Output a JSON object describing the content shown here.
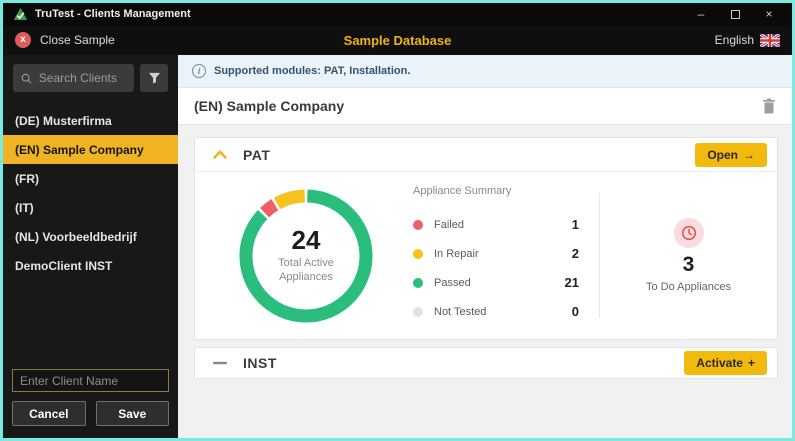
{
  "window": {
    "title": "TruTest - Clients Management",
    "controls": {
      "minimize": "–",
      "close": "×"
    }
  },
  "header": {
    "close_label": "Close Sample",
    "close_glyph": "x",
    "title": "Sample Database",
    "language": "English"
  },
  "sidebar": {
    "search_placeholder": "Search Clients",
    "clients": [
      {
        "label": "(DE) Musterfirma",
        "selected": false
      },
      {
        "label": "(EN) Sample Company",
        "selected": true
      },
      {
        "label": "(FR)",
        "selected": false
      },
      {
        "label": "(IT)",
        "selected": false
      },
      {
        "label": "(NL) Voorbeeldbedrijf",
        "selected": false
      },
      {
        "label": "DemoClient INST",
        "selected": false
      }
    ],
    "new_client_placeholder": "Enter Client Name",
    "cancel_label": "Cancel",
    "save_label": "Save"
  },
  "main": {
    "banner": "Supported modules: PAT, Installation.",
    "info_glyph": "i",
    "client_title": "(EN) Sample Company",
    "pat": {
      "title": "PAT",
      "open_label": "Open",
      "open_arrow": "→",
      "todo": {
        "value": "3",
        "label": "To Do Appliances"
      }
    },
    "inst": {
      "title": "INST",
      "activate_label": "Activate",
      "activate_plus": "+"
    }
  },
  "chart_data": {
    "type": "pie",
    "variant": "donut",
    "title": "Appliance Summary",
    "center_value": "24",
    "center_label": "Total Active Appliances",
    "segments": [
      {
        "label": "Failed",
        "value": 1,
        "color": "#ec6168"
      },
      {
        "label": "In Repair",
        "value": 2,
        "color": "#f5c21e"
      },
      {
        "label": "Passed",
        "value": 21,
        "color": "#2abd7e"
      },
      {
        "label": "Not Tested",
        "value": 0,
        "color": "#e2e2e2"
      }
    ],
    "donut_order": [
      "Passed",
      "Failed",
      "In Repair"
    ],
    "start_angle_deg": 0,
    "segment_gap_deg": 2.5,
    "legend_position": "right"
  },
  "colors": {
    "accent_yellow": "#f0b324",
    "window_border": "#79e9e2",
    "banner_bg": "#eaf2fa",
    "todo_icon": "#e05252"
  }
}
